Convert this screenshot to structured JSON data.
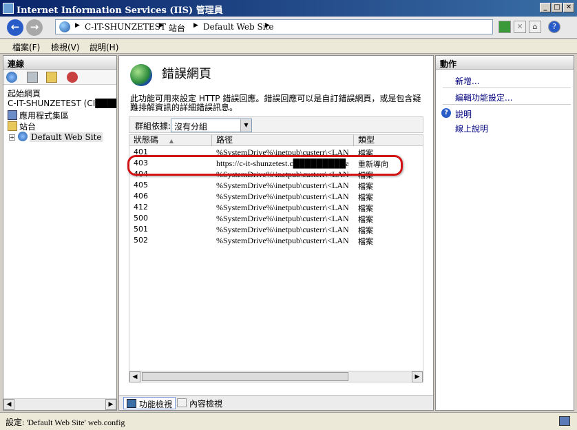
{
  "window": {
    "title": "Internet Information Services (IIS) 管理員",
    "controls": [
      "_",
      "□",
      "✕"
    ]
  },
  "address": {
    "crumbs": [
      "C-IT-SHUNZETEST",
      "站台",
      "Default Web Site"
    ],
    "separator": "▶",
    "help_label": "?"
  },
  "menu": {
    "items": [
      "檔案(F)",
      "檢視(V)",
      "說明(H)"
    ]
  },
  "connections": {
    "header": "連線",
    "tree": [
      {
        "label": "起始網頁",
        "icon": "none"
      },
      {
        "label": "C-IT-SHUNZETEST (CI█████████E/",
        "icon": "none"
      },
      {
        "label": "應用程式集區",
        "icon": "app-pool-icon"
      },
      {
        "label": "站台",
        "icon": "sites-folder-icon"
      },
      {
        "label": "Default Web Site",
        "icon": "web-site-icon",
        "expander": "+"
      }
    ]
  },
  "feature": {
    "title": "錯誤網頁",
    "description": "此功能可用來設定 HTTP 錯誤回應。錯誤回應可以是自訂錯誤網頁，或是包含疑難排解資訊的詳細錯誤訊息。",
    "groupby_label": "群組依據:",
    "groupby_value": "沒有分組",
    "columns": [
      "狀態碼",
      "路徑",
      "類型"
    ],
    "sort_indicator": "▲",
    "rows": [
      {
        "status": "401",
        "path": "%SystemDrive%\\inetpub\\custerr\\<LAN…",
        "type": "檔案"
      },
      {
        "status": "403",
        "path": "https://c-it-shunzetest.c█████████a.com.tw/",
        "type": "重新導向"
      },
      {
        "status": "404",
        "path": "%SystemDrive%\\inetpub\\custerr\\<LAN…",
        "type": "檔案"
      },
      {
        "status": "405",
        "path": "%SystemDrive%\\inetpub\\custerr\\<LAN…",
        "type": "檔案"
      },
      {
        "status": "406",
        "path": "%SystemDrive%\\inetpub\\custerr\\<LAN…",
        "type": "檔案"
      },
      {
        "status": "412",
        "path": "%SystemDrive%\\inetpub\\custerr\\<LAN…",
        "type": "檔案"
      },
      {
        "status": "500",
        "path": "%SystemDrive%\\inetpub\\custerr\\<LAN…",
        "type": "檔案"
      },
      {
        "status": "501",
        "path": "%SystemDrive%\\inetpub\\custerr\\<LAN…",
        "type": "檔案"
      },
      {
        "status": "502",
        "path": "%SystemDrive%\\inetpub\\custerr\\<LAN…",
        "type": "檔案"
      }
    ],
    "highlight_color": "#d41414",
    "tabs": [
      "功能檢視",
      "內容檢視"
    ]
  },
  "actions": {
    "header": "動作",
    "add": "新增...",
    "edit": "編輯功能設定...",
    "help": "說明",
    "online_help": "線上說明"
  },
  "status": {
    "text": "設定: 'Default Web Site' web.config"
  }
}
